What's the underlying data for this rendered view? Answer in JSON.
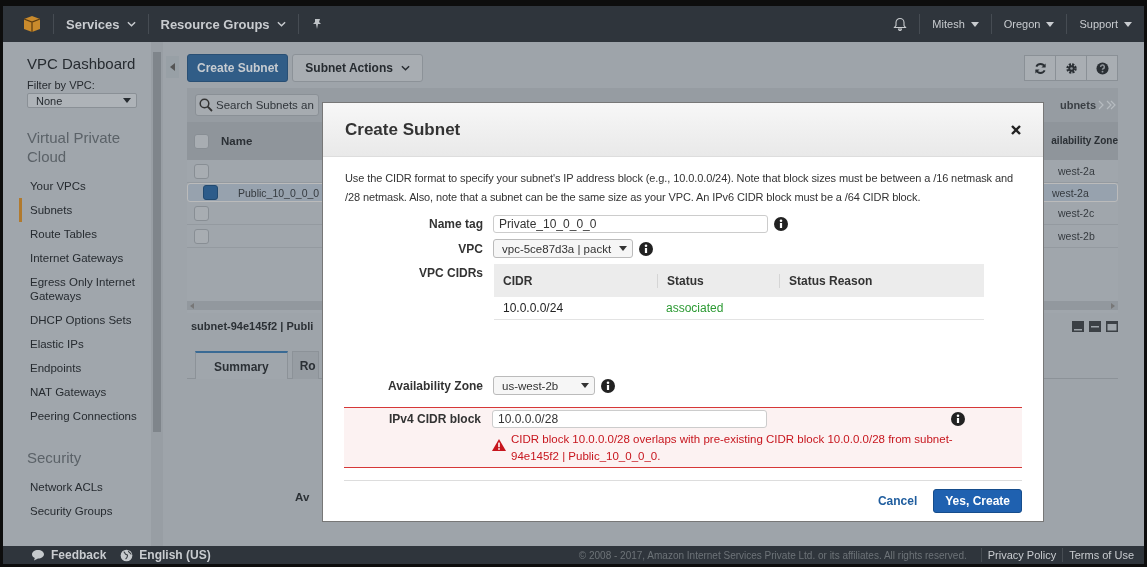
{
  "top_nav": {
    "services": "Services",
    "resource_groups": "Resource Groups",
    "user": "Mitesh",
    "region": "Oregon",
    "support": "Support"
  },
  "sidebar": {
    "title": "VPC Dashboard",
    "filter_label": "Filter by VPC:",
    "filter_value": "None",
    "sections": [
      {
        "heading": "Virtual Private Cloud",
        "items": [
          {
            "label": "Your VPCs",
            "selected": false
          },
          {
            "label": "Subnets",
            "selected": true
          },
          {
            "label": "Route Tables",
            "selected": false
          },
          {
            "label": "Internet Gateways",
            "selected": false
          },
          {
            "label": "Egress Only Internet Gateways",
            "selected": false
          },
          {
            "label": "DHCP Options Sets",
            "selected": false
          },
          {
            "label": "Elastic IPs",
            "selected": false
          },
          {
            "label": "Endpoints",
            "selected": false
          },
          {
            "label": "NAT Gateways",
            "selected": false
          },
          {
            "label": "Peering Connections",
            "selected": false
          }
        ]
      },
      {
        "heading": "Security",
        "items": [
          {
            "label": "Network ACLs",
            "selected": false
          },
          {
            "label": "Security Groups",
            "selected": false
          }
        ]
      }
    ]
  },
  "toolbar": {
    "primary": "Create Subnet",
    "actions": "Subnet Actions"
  },
  "table": {
    "search_placeholder": "Search Subnets an",
    "select_all_checked": false,
    "pager": "ubnets",
    "columns": [
      "Name",
      "ailability Zone"
    ],
    "rows": [
      {
        "zone": "west-2a",
        "selected": false,
        "checked": false
      },
      {
        "name": "Public_10_0_0_0",
        "zone": "west-2a",
        "selected": true,
        "checked": true
      },
      {
        "zone": "west-2c",
        "selected": false,
        "checked": false
      },
      {
        "zone": "west-2b",
        "selected": false,
        "checked": false
      }
    ]
  },
  "details": {
    "title": "subnet-94e145f2 | Publi",
    "tabs": [
      {
        "label": "Summary",
        "selected": true
      },
      {
        "label": "Ro",
        "selected": false
      }
    ],
    "field_label": "Av"
  },
  "dialog": {
    "title": "Create Subnet",
    "description": "Use the CIDR format to specify your subnet's IP address block (e.g., 10.0.0.0/24). Note that block sizes must be between a /16 netmask and /28 netmask. Also, note that a subnet can be the same size as your VPC. An IPv6 CIDR block must be a /64 CIDR block.",
    "name_tag": {
      "label": "Name tag",
      "value": "Private_10_0_0_0"
    },
    "vpc": {
      "label": "VPC",
      "value": "vpc-5ce87d3a | packt"
    },
    "vpc_cidrs": {
      "label": "VPC CIDRs",
      "columns": [
        "CIDR",
        "Status",
        "Status Reason"
      ],
      "rows": [
        {
          "cidr": "10.0.0.0/24",
          "status": "associated"
        }
      ]
    },
    "availability_zone": {
      "label": "Availability Zone",
      "value": "us-west-2b"
    },
    "ipv4_cidr": {
      "label": "IPv4 CIDR block",
      "value": "10.0.0.0/28",
      "error": "CIDR block 10.0.0.0/28 overlaps with pre-existing CIDR block 10.0.0.0/28 from subnet-94e145f2 | Public_10_0_0_0."
    },
    "buttons": {
      "cancel": "Cancel",
      "confirm": "Yes, Create"
    }
  },
  "footer": {
    "feedback": "Feedback",
    "language": "English (US)",
    "copyright": "© 2008 - 2017, Amazon Internet Services Private Ltd. or its affiliates. All rights reserved.",
    "links": [
      "Privacy Policy",
      "Terms of Use"
    ]
  }
}
